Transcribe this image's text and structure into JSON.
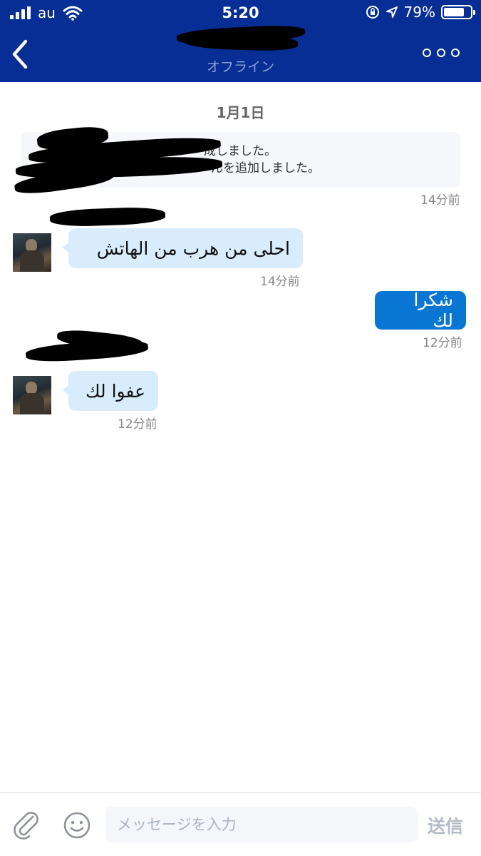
{
  "status_bar": {
    "carrier": "au",
    "time": "5:20",
    "battery_percent_label": "79%",
    "battery_level": 0.79,
    "icons": [
      "signal-icon",
      "wifi-icon",
      "orientation-lock-icon",
      "location-icon",
      "battery-icon"
    ]
  },
  "header": {
    "subtitle": "オフライン",
    "back_icon": "chevron-left-icon",
    "more_icon": "more-options-icon",
    "accent": "#062e94"
  },
  "chat": {
    "date_separator": "1月1日",
    "system_message": {
      "line1": "成しました。",
      "line2": "んを追加しました。",
      "time": "14分前"
    },
    "messages": [
      {
        "direction": "incoming",
        "text": "احلى من هرب من الهاتش",
        "time": "14分前"
      },
      {
        "direction": "outgoing",
        "text": "شكرا لك",
        "time": "12分前"
      },
      {
        "direction": "incoming",
        "text": "عفوا لك",
        "time": "12分前"
      }
    ],
    "incoming_bubble_color": "#d8ecfb",
    "outgoing_bubble_color": "#0a76d4"
  },
  "composer": {
    "placeholder": "メッセージを入力",
    "send_label": "送信",
    "attach_icon": "paperclip-icon",
    "emoji_icon": "emoji-icon"
  }
}
